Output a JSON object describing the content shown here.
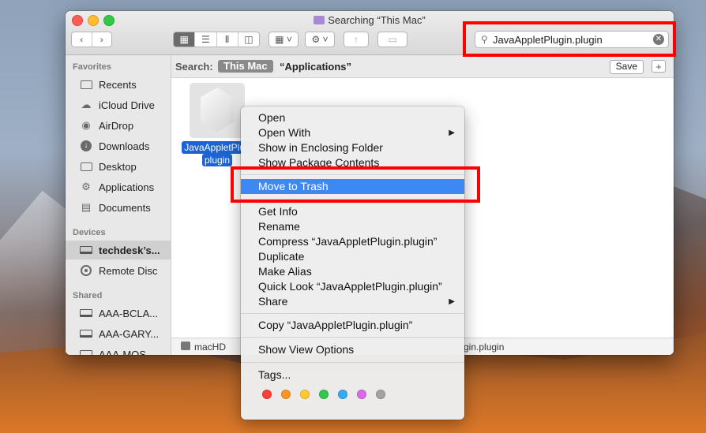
{
  "window": {
    "title": "Searching “This Mac”"
  },
  "toolbar": {
    "back": "‹",
    "forward": "›",
    "view_icons": "▦",
    "view_list": "☰",
    "view_columns": "Ⅱ",
    "view_cover": "◫",
    "arrange": "▦ ˅",
    "action": "⚙ ˅",
    "share": "↑",
    "tag": "▭"
  },
  "search": {
    "value": "JavaAppletPlugin.plugin",
    "clear": "✕"
  },
  "sidebar": {
    "favorites_header": "Favorites",
    "favorites": [
      {
        "label": "Recents"
      },
      {
        "label": "iCloud Drive"
      },
      {
        "label": "AirDrop"
      },
      {
        "label": "Downloads"
      },
      {
        "label": "Desktop"
      },
      {
        "label": "Applications"
      },
      {
        "label": "Documents"
      }
    ],
    "devices_header": "Devices",
    "devices": [
      {
        "label": "techdesk’s..."
      },
      {
        "label": "Remote Disc"
      }
    ],
    "shared_header": "Shared",
    "shared": [
      {
        "label": "AAA-BCLA..."
      },
      {
        "label": "AAA-GARY..."
      },
      {
        "label": "AAA-MOS..."
      }
    ]
  },
  "scope": {
    "label": "Search:",
    "this_mac": "This Mac",
    "applications": "“Applications”",
    "save": "Save",
    "add": "+"
  },
  "file": {
    "name_line1": "JavaAppletPlug",
    "name_line2": "plugin"
  },
  "pathbar": {
    "root": "macHD",
    "file": "gin.plugin"
  },
  "context_menu": {
    "items": [
      {
        "label": "Open"
      },
      {
        "label": "Open With",
        "submenu": "▶"
      },
      {
        "label": "Show in Enclosing Folder"
      },
      {
        "label": "Show Package Contents"
      },
      {
        "label": "Move to Trash"
      },
      {
        "label": "Get Info"
      },
      {
        "label": "Rename"
      },
      {
        "label": "Compress “JavaAppletPlugin.plugin”"
      },
      {
        "label": "Duplicate"
      },
      {
        "label": "Make Alias"
      },
      {
        "label": "Quick Look “JavaAppletPlugin.plugin”"
      },
      {
        "label": "Share",
        "submenu": "▶"
      },
      {
        "label": "Copy “JavaAppletPlugin.plugin”"
      },
      {
        "label": "Show View Options"
      },
      {
        "label": "Tags..."
      }
    ],
    "highlighted_item": "Move to Trash",
    "tag_colors": [
      "#fc3d39",
      "#fd9426",
      "#fecb2e",
      "#30c94b",
      "#35aaf2",
      "#d86ce6",
      "#a2a2a2"
    ]
  },
  "annotation_color": "#ff0000"
}
